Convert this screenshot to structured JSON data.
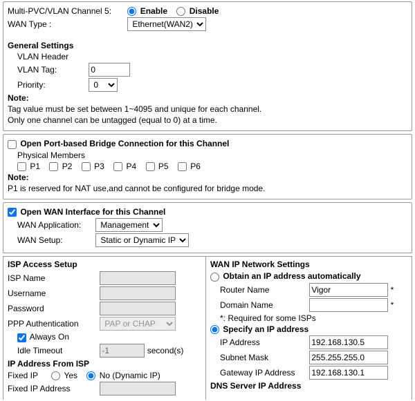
{
  "header": {
    "channel_label": "Multi-PVC/VLAN Channel 5:",
    "enable_label": "Enable",
    "disable_label": "Disable",
    "enable_selected": true,
    "wan_type_label": "WAN Type  :",
    "wan_type_value": "Ethernet(WAN2)"
  },
  "general": {
    "title": "General Settings",
    "vlan_header_label": "VLAN Header",
    "vlan_tag_label": "VLAN Tag:",
    "vlan_tag_value": "0",
    "priority_label": "Priority:",
    "priority_value": "0",
    "note_title": "Note:",
    "note1": "Tag value must be set between 1~4095 and unique for each channel.",
    "note2": "Only one channel can be untagged (equal to 0) at a time."
  },
  "bridge": {
    "open_label": "Open Port-based Bridge Connection for this Channel",
    "open_checked": false,
    "members_label": "Physical Members",
    "ports": [
      "P1",
      "P2",
      "P3",
      "P4",
      "P5",
      "P6"
    ],
    "note_title": "Note:",
    "note1": "P1 is reserved for NAT use,and cannot be configured for bridge mode."
  },
  "wan_iface": {
    "open_label": "Open WAN Interface for this Channel",
    "open_checked": true,
    "app_label": "WAN Application:",
    "app_value": "Management",
    "setup_label": "WAN Setup:",
    "setup_value": "Static or Dynamic IP"
  },
  "isp": {
    "title": "ISP Access Setup",
    "name_label": "ISP Name",
    "name_value": "",
    "user_label": "Username",
    "user_value": "",
    "pass_label": "Password",
    "pass_value": "",
    "auth_label": "PPP Authentication",
    "auth_value": "PAP or CHAP",
    "always_on_label": "Always On",
    "always_on_checked": true,
    "idle_label": "Idle Timeout",
    "idle_value": "-1",
    "idle_unit": "second(s)",
    "ipfrom_title": "IP Address From ISP",
    "fixed_ip_label": "Fixed IP",
    "yes_label": "Yes",
    "no_label": "No (Dynamic IP)",
    "fixed_ip_no_selected": true,
    "fixed_addr_label": "Fixed IP Address",
    "fixed_addr_value": ""
  },
  "net": {
    "title": "WAN IP Network Settings",
    "obtain_label": "Obtain an IP address automatically",
    "obtain_selected": false,
    "router_name_label": "Router Name",
    "router_name_value": "Vigor",
    "domain_label": "Domain Name",
    "domain_value": "",
    "req_note": "*: Required for some ISPs",
    "specify_label": "Specify an IP address",
    "specify_selected": true,
    "ip_label": "IP Address",
    "ip_value": "192.168.130.5",
    "mask_label": "Subnet Mask",
    "mask_value": "255.255.255.0",
    "gw_label": "Gateway IP Address",
    "gw_value": "192.168.130.1",
    "dns_title": "DNS Server IP Address"
  }
}
